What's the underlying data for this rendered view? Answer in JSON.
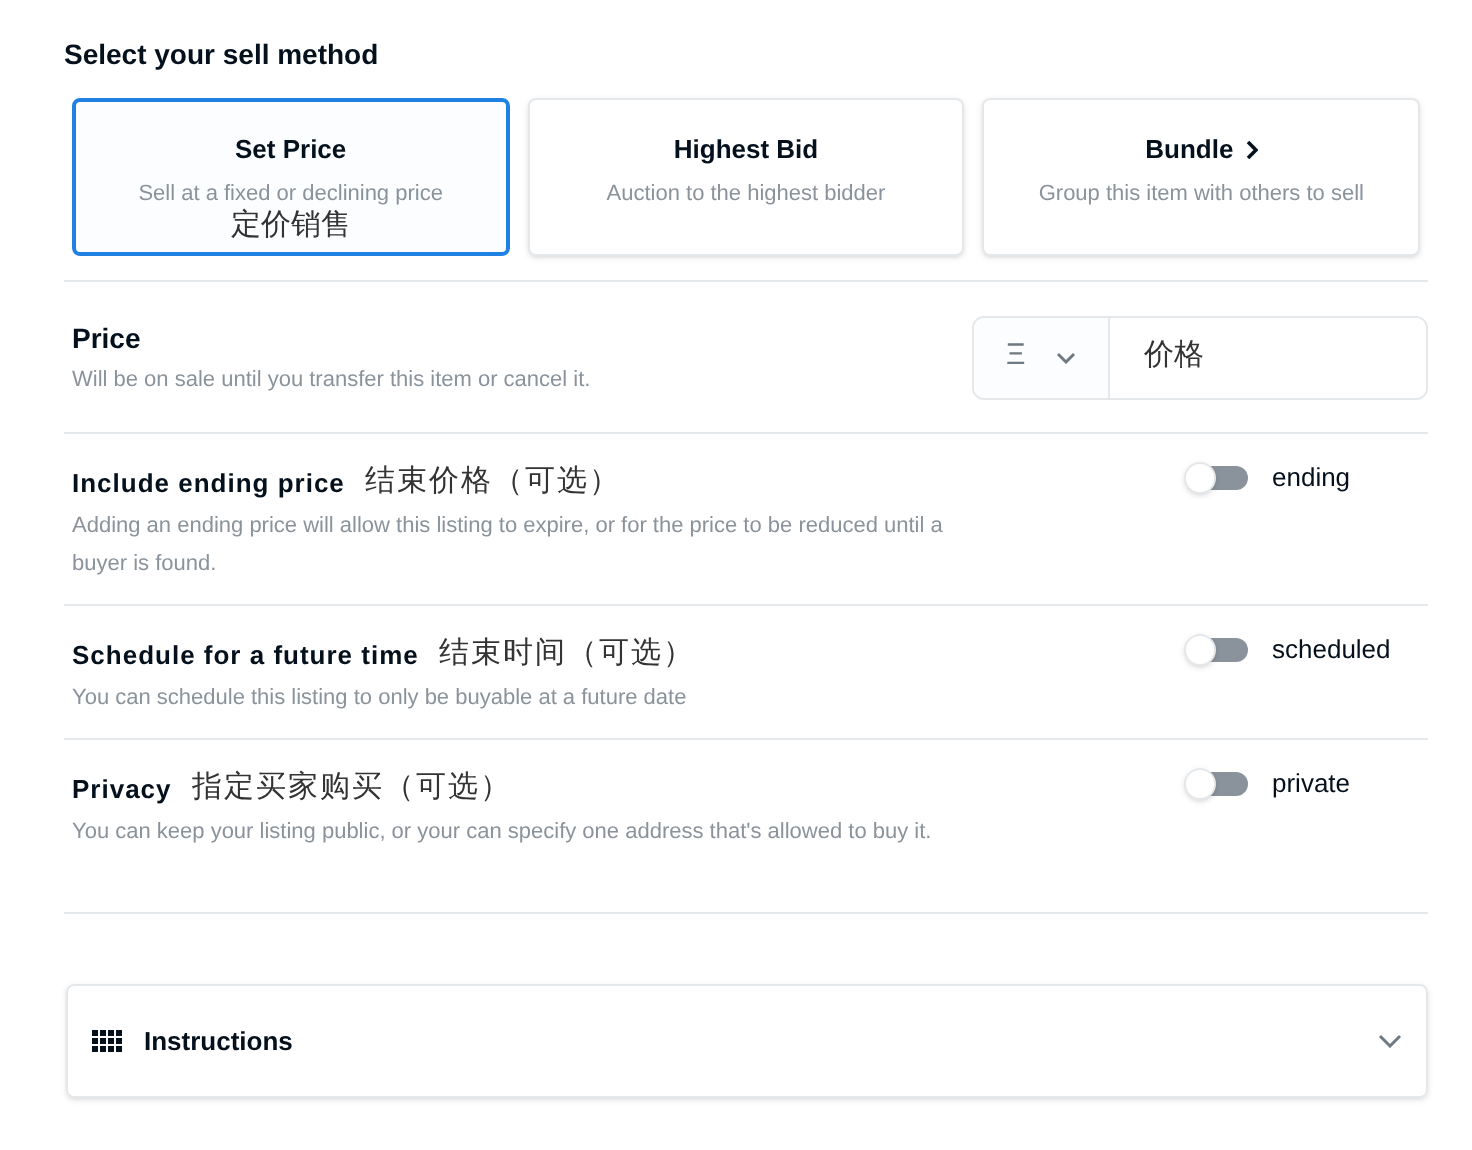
{
  "heading": "Select your sell method",
  "methods": [
    {
      "title": "Set Price",
      "subtitle": "Sell at a fixed or declining price",
      "note": "定价销售",
      "selected": true,
      "chevron": false
    },
    {
      "title": "Highest Bid",
      "subtitle": "Auction to the highest bidder",
      "selected": false,
      "chevron": false
    },
    {
      "title": "Bundle",
      "subtitle": "Group this item with others to sell",
      "selected": false,
      "chevron": true
    }
  ],
  "price": {
    "title": "Price",
    "description": "Will be on sale until you transfer this item or cancel it.",
    "currency": "Ξ",
    "note": "价格"
  },
  "options": [
    {
      "title": "Include ending price",
      "note": "结束价格（可选）",
      "description": "Adding an ending price will allow this listing to expire, or for the price to be reduced until a buyer is found.",
      "toggle_label": "ending",
      "on": false
    },
    {
      "title": "Schedule for a future time",
      "note": "结束时间（可选）",
      "description": "You can schedule this listing to only be buyable at a future date",
      "toggle_label": "scheduled",
      "on": false
    },
    {
      "title": "Privacy",
      "note": "指定买家购买（可选）",
      "description": "You can keep your listing public, or your can specify one address that's allowed to buy it.",
      "toggle_label": "private",
      "on": false
    }
  ],
  "instructions": {
    "title": "Instructions",
    "expanded": false
  }
}
